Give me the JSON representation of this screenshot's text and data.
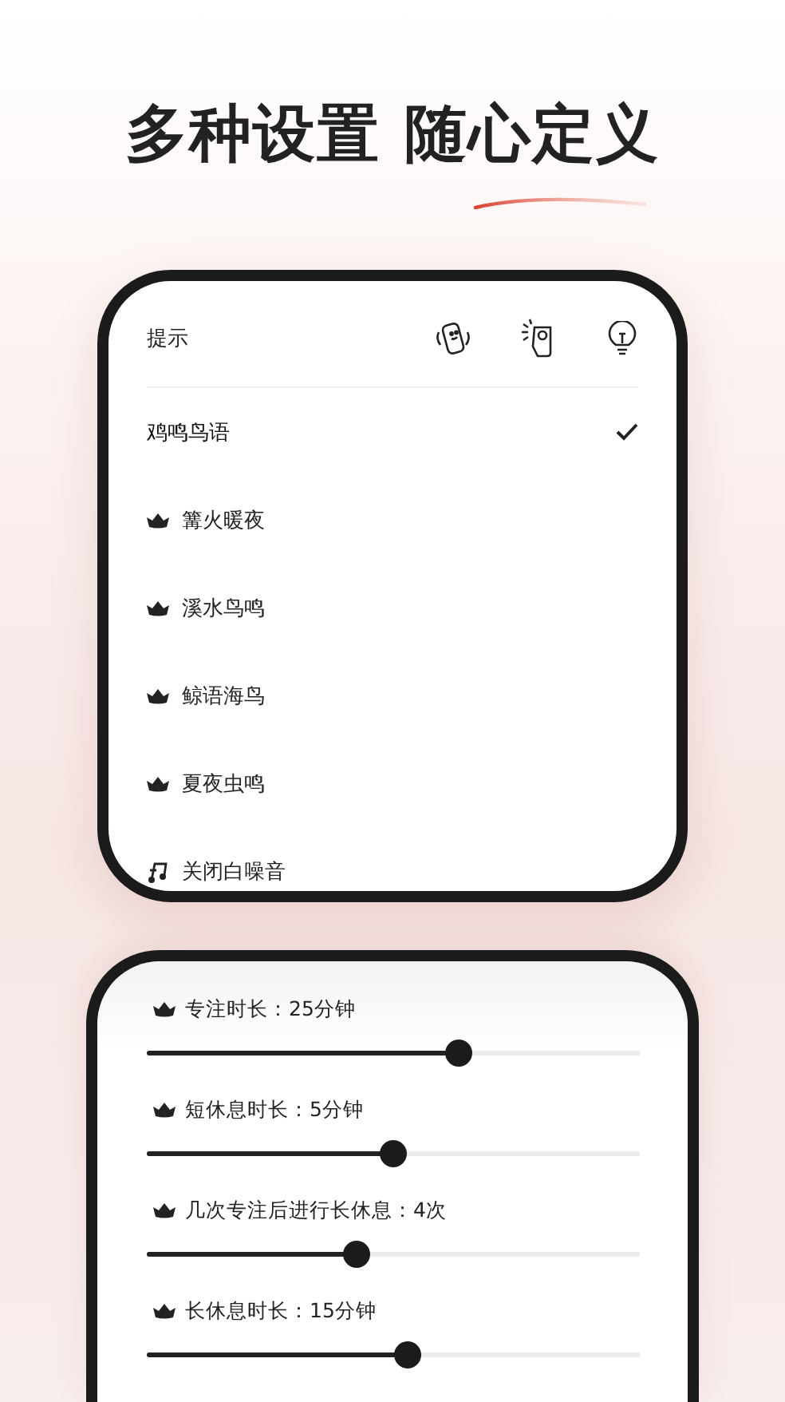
{
  "headline": "多种设置 随心定义",
  "sound_card": {
    "header": {
      "title": "提示"
    },
    "items": [
      {
        "kind": "plain",
        "label": "鸡鸣鸟语",
        "selected": true
      },
      {
        "kind": "premium",
        "label": "篝火暖夜",
        "selected": false
      },
      {
        "kind": "premium",
        "label": "溪水鸟鸣",
        "selected": false
      },
      {
        "kind": "premium",
        "label": "鲸语海鸟",
        "selected": false
      },
      {
        "kind": "premium",
        "label": "夏夜虫鸣",
        "selected": false
      },
      {
        "kind": "off",
        "label": "关闭白噪音",
        "selected": false
      }
    ]
  },
  "timer_card": {
    "sliders": [
      {
        "label": "专注时长：25分钟",
        "level": 0.64
      },
      {
        "label": "短休息时长：5分钟",
        "level": 0.5
      },
      {
        "label": "几次专注后进行长休息：4次",
        "level": 0.42
      },
      {
        "label": "长休息时长：15分钟",
        "level": 0.53
      }
    ]
  }
}
